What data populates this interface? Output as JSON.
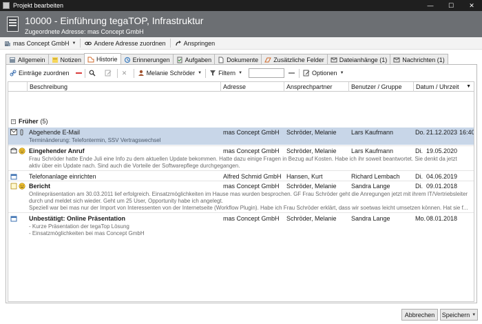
{
  "window": {
    "title": "Projekt bearbeiten",
    "minimize": "—",
    "maximize": "☐",
    "close": "✕"
  },
  "header": {
    "title": "10000 - Einführung tegaTOP, Infrastruktur",
    "subtitle": "Zugeordnete Adresse: mas Concept GmbH"
  },
  "toolbar": {
    "company": "mas Concept GmbH",
    "assign_other": "Andere Adresse zuordnen",
    "jump": "Anspringen"
  },
  "tabs": [
    {
      "label": "Allgemein",
      "icon": "general-icon"
    },
    {
      "label": "Notizen",
      "icon": "notes-icon"
    },
    {
      "label": "Historie",
      "icon": "history-icon",
      "active": true
    },
    {
      "label": "Erinnerungen",
      "icon": "reminder-icon"
    },
    {
      "label": "Aufgaben",
      "icon": "tasks-icon"
    },
    {
      "label": "Dokumente",
      "icon": "documents-icon"
    },
    {
      "label": "Zusätzliche Felder",
      "icon": "fields-icon"
    },
    {
      "label": "Dateianhänge (1)",
      "icon": "attachments-icon"
    },
    {
      "label": "Nachrichten (1)",
      "icon": "messages-icon"
    }
  ],
  "subtoolbar": {
    "assign_entries": "Einträge zuordnen",
    "user": "Melanie Schröder",
    "filter": "Filtern",
    "filter_value": "",
    "options": "Optionen"
  },
  "columns": [
    "Beschreibung",
    "Adresse",
    "Ansprechpartner",
    "Benutzer / Gruppe",
    "Datum / Uhrzeit"
  ],
  "group": {
    "label": "Früher",
    "count": "(5)",
    "toggle": "−"
  },
  "rows": [
    {
      "desc": "Abgehende E-Mail",
      "addr": "mas Concept GmbH",
      "contact": "Schröder, Melanie",
      "user": "Lars Kaufmann",
      "day": "Do.",
      "date": "21.12.2023",
      "time": "16:40",
      "note": [
        "Terminänderung: Telefontermin, SSV Vertragswechsel"
      ]
    },
    {
      "desc": "Eingehender Anruf",
      "addr": "mas Concept GmbH",
      "contact": "Schröder, Melanie",
      "user": "Lars Kaufmann",
      "day": "Di.",
      "date": "19.05.2020",
      "time": "",
      "note": [
        "Frau Schröder hatte Ende Juli eine Info zu dem aktuellen Update bekommen. Hatte dazu einige Fragen in Bezug auf Kosten. Habe ich ihr soweit beantwortet. Sie denkt da jetzt",
        "aktiv über ein Update nach. Sind auch die Vorteile der Softwarepflege durchgegangen."
      ]
    },
    {
      "desc": "Telefonanlage einrichten",
      "addr": "Alfred Schmid GmbH",
      "contact": "Hansen, Kurt",
      "user": "Richard Lembach",
      "day": "Di.",
      "date": "04.06.2019",
      "time": "",
      "note": []
    },
    {
      "desc": "Bericht",
      "addr": "mas Concept GmbH",
      "contact": "Schröder, Melanie",
      "user": "Sandra Lange",
      "day": "Di.",
      "date": "09.01.2018",
      "time": "",
      "note": [
        "Onlinepräsentation am 30.03.2011 lief erfolgreich. Einsatzmöglichkeiten im Hause mas wurden besprochen. GF Frau Schröder geht die Anregungen jetzt mit ihrem IT/Vertriebsleiter",
        "durch und meldet sich wieder. Geht um 25 User, Opportunity habe ich angelegt.",
        "Speziell war bei mas nur der Import von Interessenten von der Internetseite (Workflow Plugin). Habe ich Frau Schröder erklärt, dass wir soetwas leicht umsetzen können. Hat sie f..."
      ]
    },
    {
      "desc": "Unbestätigt: Online Präsentation",
      "addr": "mas Concept GmbH",
      "contact": "Schröder, Melanie",
      "user": "Sandra Lange",
      "day": "Mo.",
      "date": "08.01.2018",
      "time": "",
      "note": [
        "- Kurze Präsentation der tegaTop Lösung",
        "- Einsatzmöglichkeiten bei mas Concept GmbH"
      ]
    }
  ],
  "buttons": {
    "cancel": "Abbrechen",
    "save": "Speichern"
  }
}
